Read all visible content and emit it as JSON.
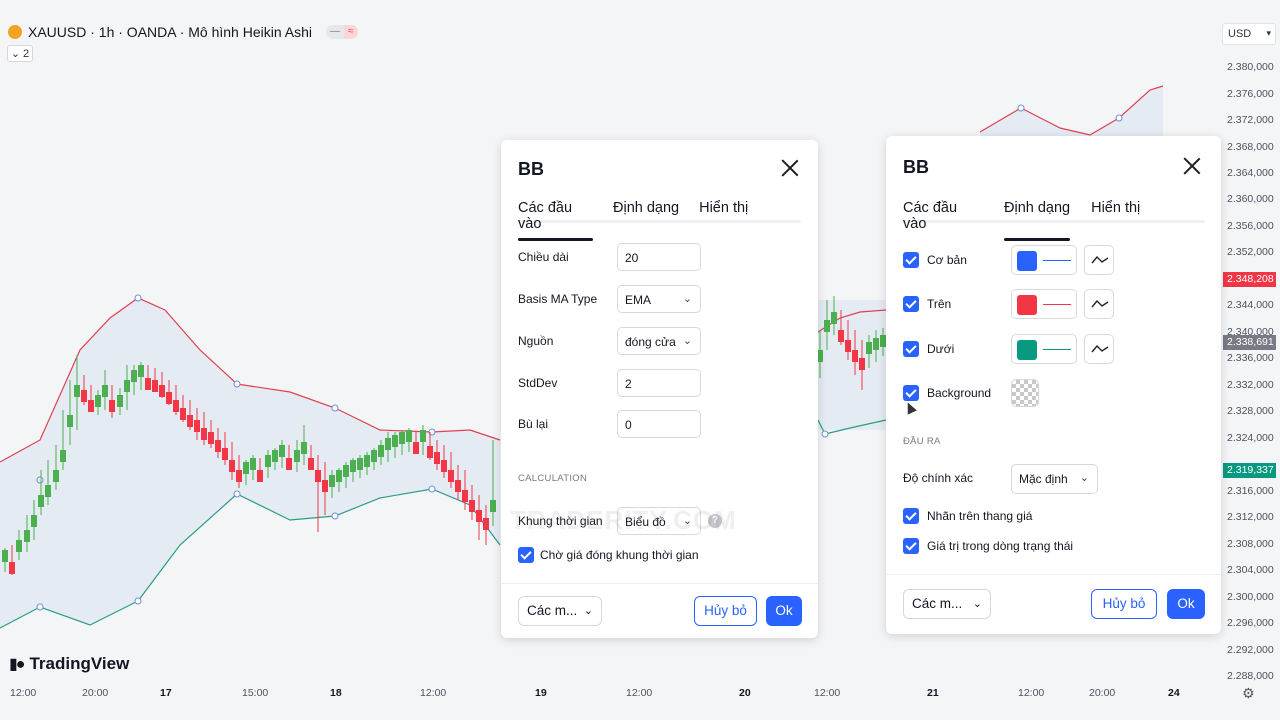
{
  "header": {
    "symbol_title": "XAUUSD · 1h · OANDA · Mô hình Heikin Ashi",
    "indicator_count": "2",
    "currency": "USD"
  },
  "price_axis": {
    "ticks": [
      "2.380,000",
      "2.376,000",
      "2.372,000",
      "2.368,000",
      "2.364,000",
      "2.360,000",
      "2.356,000",
      "2.352,000",
      "2.344,000",
      "2.340,000",
      "2.336,000",
      "2.332,000",
      "2.328,000",
      "2.324,000",
      "2.316,000",
      "2.312,000",
      "2.308,000",
      "2.304,000",
      "2.300,000",
      "2.296,000",
      "2.292,000",
      "2.288,000"
    ],
    "tag_red": "2.348,208",
    "tag_gray": "2.338,691",
    "tag_green": "2.319,337"
  },
  "time_axis": {
    "labels": [
      "12:00",
      "20:00",
      "17",
      "15:00",
      "18",
      "12:00",
      "19",
      "12:00",
      "20",
      "12:00",
      "21",
      "12:00",
      "20:00",
      "24"
    ]
  },
  "brand": {
    "name": "TradingView"
  },
  "watermark": "TRADERITY.COM",
  "colors": {
    "accent": "#2962ff",
    "up": "#26a69a",
    "down": "#ef5350",
    "candle_up": "#4caf50",
    "candle_down": "#f23645"
  },
  "dialog_inputs": {
    "title": "BB",
    "tabs": [
      "Các đầu vào",
      "Định dạng",
      "Hiển thị"
    ],
    "rows": [
      {
        "label": "Chiều dài",
        "value": "20"
      },
      {
        "label": "Basis MA Type",
        "value": "EMA"
      },
      {
        "label": "Nguồn",
        "value": "đóng cửa"
      },
      {
        "label": "StdDev",
        "value": "2"
      },
      {
        "label": "Bù lại",
        "value": "0"
      }
    ],
    "section": "CALCULATION",
    "timeframe_label": "Khung thời gian",
    "timeframe_value": "Biểu đồ",
    "wait_close_label": "Chờ giá đóng khung thời gian",
    "footer": {
      "more": "Các m...",
      "cancel": "Hủy bỏ",
      "ok": "Ok"
    }
  },
  "dialog_style": {
    "title": "BB",
    "tabs": [
      "Các đầu vào",
      "Định dạng",
      "Hiển thị"
    ],
    "plots": [
      {
        "label": "Cơ bản",
        "color": "#2962ff"
      },
      {
        "label": "Trên",
        "color": "#f23645"
      },
      {
        "label": "Dưới",
        "color": "#089981"
      },
      {
        "label": "Background"
      }
    ],
    "output_section": "ĐẦU RA",
    "precision_label": "Độ chính xác",
    "precision_value": "Mặc định",
    "labels_on_scale": "Nhãn trên thang giá",
    "values_in_status": "Giá trị trong dòng trạng thái",
    "footer": {
      "more": "Các m...",
      "cancel": "Hủy bỏ",
      "ok": "Ok"
    }
  }
}
